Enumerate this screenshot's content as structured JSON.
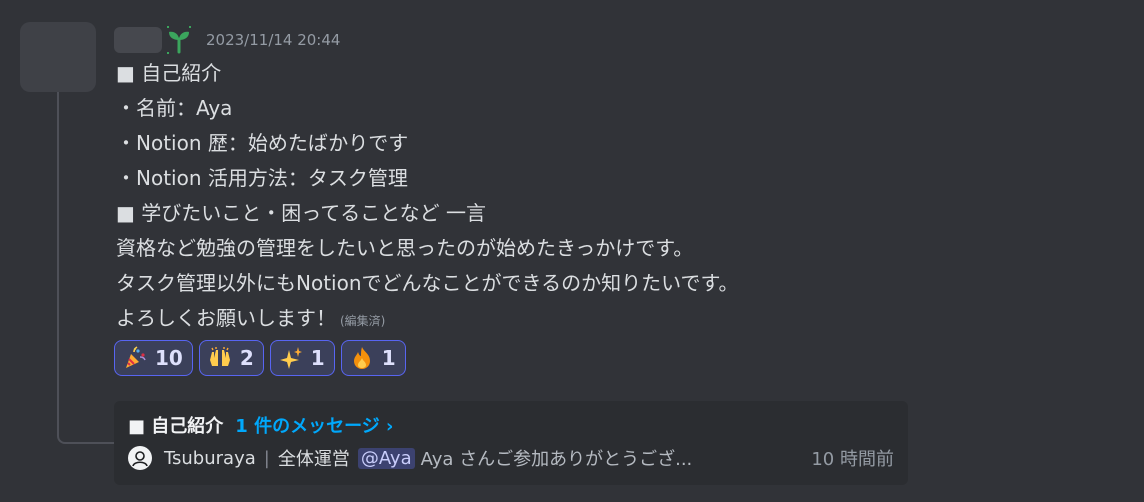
{
  "message": {
    "timestamp": "2023/11/14 20:44",
    "lines": [
      "■ 自己紹介",
      "・名前：Aya",
      "・Notion 歴：始めたばかりです",
      "・Notion 活用方法：タスク管理",
      "■ 学びたいこと・困ってることなど 一言",
      "資格など勉強の管理をしたいと思ったのが始めたきっかけです。",
      "タスク管理以外にもNotionでどんなことができるのか知りたいです。",
      "よろしくお願いします！"
    ],
    "edited_label": "(編集済)"
  },
  "reactions": [
    {
      "emoji": "party-popper",
      "count": "10"
    },
    {
      "emoji": "raising-hands",
      "count": "2"
    },
    {
      "emoji": "sparkles",
      "count": "1"
    },
    {
      "emoji": "fire",
      "count": "1"
    }
  ],
  "thread": {
    "name": "■ 自己紹介",
    "message_count": "1 件のメッセージ ›",
    "last_reply": {
      "author": "Tsuburaya",
      "separator": "|",
      "role": "全体運営",
      "mention": "@Aya",
      "text": "Aya さんご参加ありがとうござ...",
      "time": "10 時間前"
    }
  },
  "colors": {
    "background": "#313338",
    "accent": "#5865f2",
    "link": "#00a8fc",
    "role_icon": "#3ba55d"
  }
}
